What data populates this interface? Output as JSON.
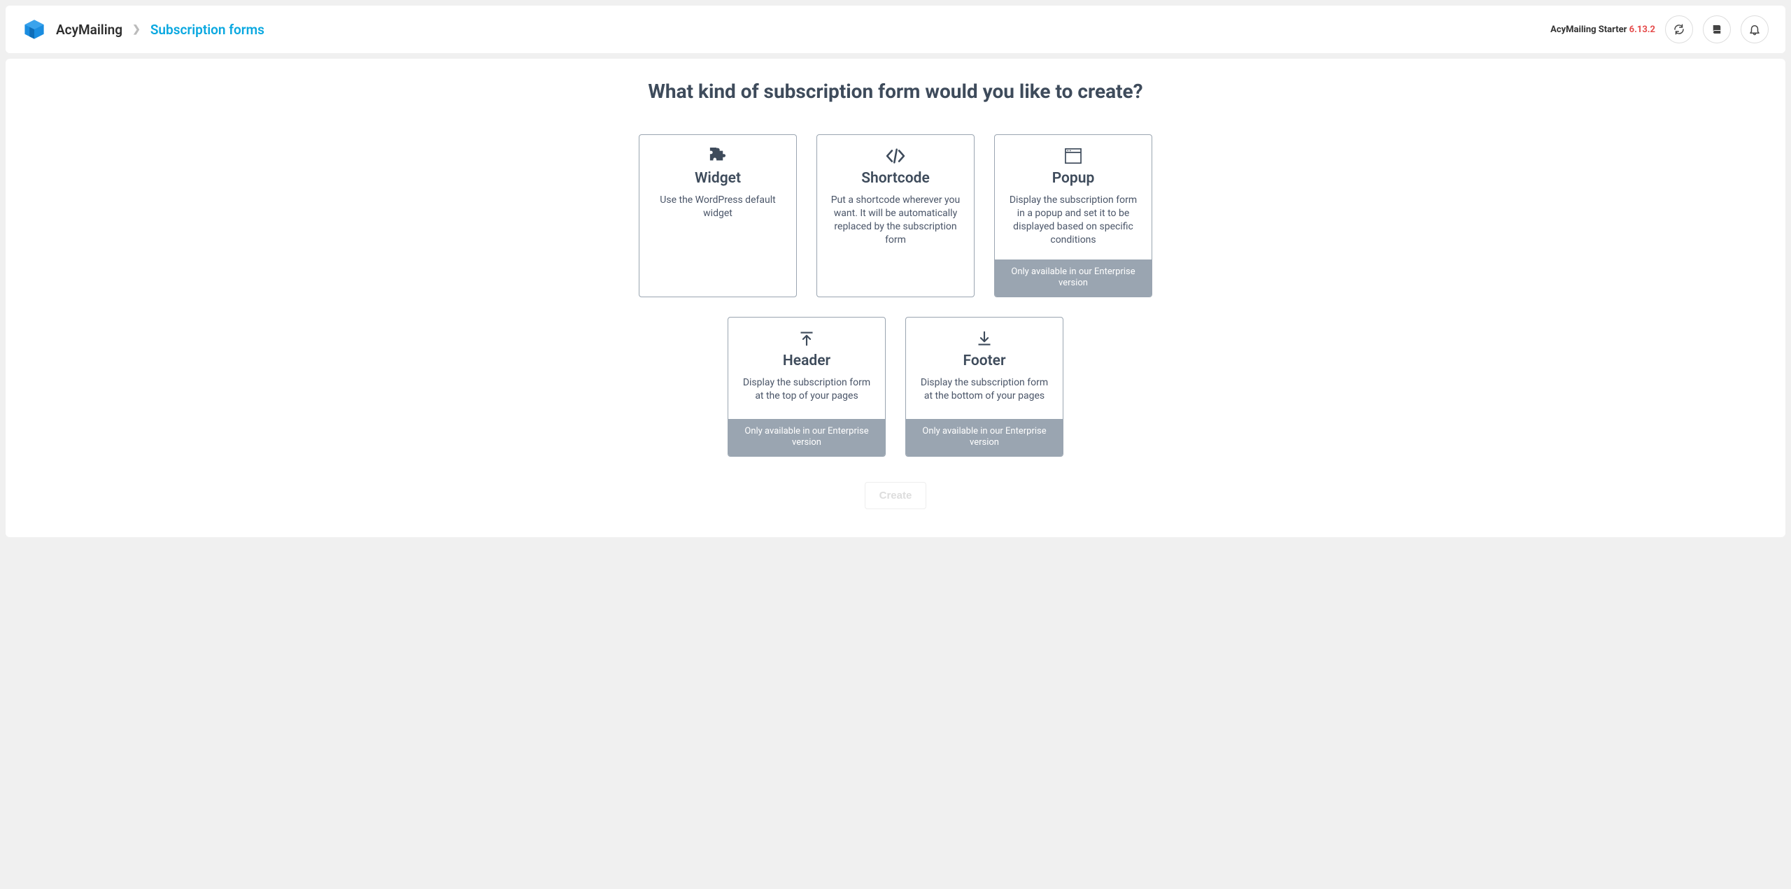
{
  "header": {
    "app_name": "AcyMailing",
    "page_name": "Subscription forms",
    "plan_name": "AcyMailing Starter",
    "plan_version": "6.13.2"
  },
  "main": {
    "title": "What kind of subscription form would you like to create?",
    "create_label": "Create",
    "cards": {
      "widget": {
        "title": "Widget",
        "desc": "Use the WordPress default widget"
      },
      "shortcode": {
        "title": "Shortcode",
        "desc": "Put a shortcode wherever you want. It will be automatically replaced by the subscription form"
      },
      "popup": {
        "title": "Popup",
        "desc": "Display the subscription form in a popup and set it to be displayed based on specific conditions",
        "banner": "Only available in our Enterprise version"
      },
      "headerform": {
        "title": "Header",
        "desc": "Display the subscription form at the top of your pages",
        "banner": "Only available in our Enterprise version"
      },
      "footer": {
        "title": "Footer",
        "desc": "Display the subscription form at the bottom of your pages",
        "banner": "Only available in our Enterprise version"
      }
    }
  }
}
